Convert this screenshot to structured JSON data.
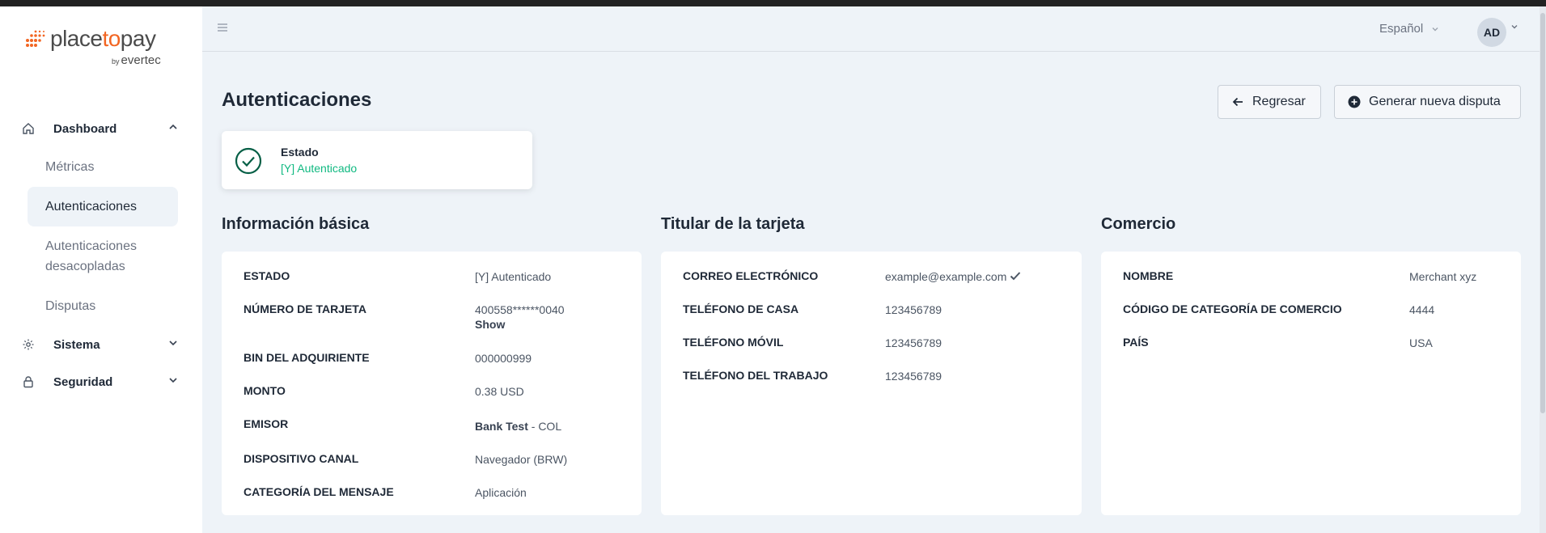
{
  "brand": {
    "name_start": "place",
    "name_mid": "to",
    "name_end": "pay",
    "sub_by": "by",
    "sub_name": "evertec",
    "color": "#f26522"
  },
  "sidebar": {
    "dashboard": {
      "label": "Dashboard",
      "icon": "home-icon"
    },
    "dashboard_items": [
      "Métricas",
      "Autenticaciones",
      "Autenticaciones desacopladas",
      "Disputas"
    ],
    "sistema": {
      "label": "Sistema",
      "icon": "gear-icon"
    },
    "seguridad": {
      "label": "Seguridad",
      "icon": "lock-icon"
    }
  },
  "header": {
    "language": "Español",
    "avatar": "AD"
  },
  "page": {
    "title": "Autenticaciones",
    "back_label": "Regresar",
    "new_dispute_label": "Generar nueva disputa"
  },
  "status": {
    "label": "Estado",
    "value": "[Y] Autenticado",
    "color": "#10b981"
  },
  "basic": {
    "title": "Información básica",
    "rows": [
      {
        "k": "ESTADO",
        "v": "[Y] Autenticado"
      },
      {
        "k": "NÚMERO DE TARJETA",
        "v": "400558******0040",
        "action": "Show"
      },
      {
        "k": "BIN DEL ADQUIRIENTE",
        "v": "000000999"
      },
      {
        "k": "MONTO",
        "v": "0.38 USD"
      },
      {
        "k": "EMISOR",
        "bank": "Bank Test",
        "v": " - COL"
      },
      {
        "k": "DISPOSITIVO CANAL",
        "v": "Navegador (BRW)"
      },
      {
        "k": "CATEGORÍA DEL MENSAJE",
        "v": "Aplicación"
      }
    ]
  },
  "holder": {
    "title": "Titular de la tarjeta",
    "rows": [
      {
        "k": "CORREO ELECTRÓNICO",
        "v": "example@example.com"
      },
      {
        "k": "TELÉFONO DE CASA",
        "v": "123456789"
      },
      {
        "k": "TELÉFONO MÓVIL",
        "v": "123456789"
      },
      {
        "k": "TELÉFONO DEL TRABAJO",
        "v": "123456789"
      }
    ]
  },
  "merchant": {
    "title": "Comercio",
    "rows": [
      {
        "k": "NOMBRE",
        "v": "Merchant xyz"
      },
      {
        "k": "CÓDIGO DE CATEGORÍA DE COMERCIO",
        "v": "4444"
      },
      {
        "k": "PAÍS",
        "v": "USA"
      }
    ]
  }
}
